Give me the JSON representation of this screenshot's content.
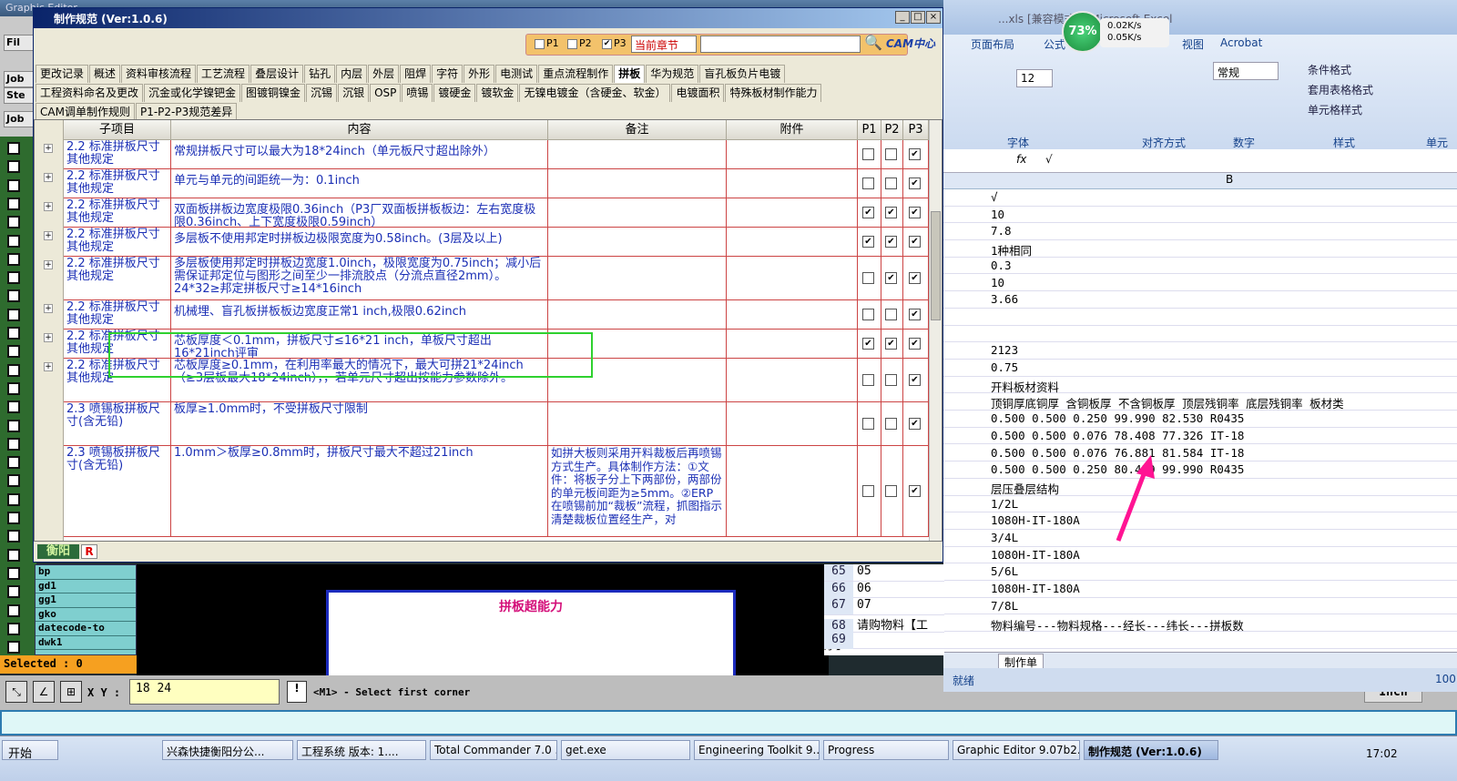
{
  "cam": {
    "left_labels": [
      "Fil",
      "Job",
      "Ste",
      "Job"
    ],
    "layers": [
      "bp",
      "gd1",
      "gg1",
      "gko",
      "datecode-to",
      "dwk1"
    ],
    "selected": "Selected : 0",
    "xy_label": "X Y :",
    "xy_value": "18 24",
    "prompt": "<M1> - Select first corner",
    "draw_label": "拼板超能力",
    "unit": "Inch"
  },
  "dialog": {
    "title": "制作规范 (Ver:1.0.6)",
    "filters": [
      "P1",
      "P2",
      "P3"
    ],
    "filter_checked": [
      false,
      false,
      true
    ],
    "scope": "当前章节",
    "search_value": "",
    "logo": "CAM中心",
    "tabs_row1": [
      "更改记录",
      "概述",
      "资料审核流程",
      "工艺流程",
      "叠层设计",
      "钻孔",
      "内层",
      "外层",
      "阻焊",
      "字符",
      "外形",
      "电测试",
      "重点流程制作",
      "拼板",
      "华为规范",
      "盲孔板负片电镀"
    ],
    "tabs_row2": [
      "工程资料命名及更改",
      "沉金或化学镍钯金",
      "图镀铜镍金",
      "沉锡",
      "沉银",
      "OSP",
      "喷锡",
      "镀硬金",
      "镀软金",
      "无镍电镀金（含硬金、软金）",
      "电镀面积",
      "特殊板材制作能力"
    ],
    "tabs_row3": [
      "CAM调单制作规则",
      "P1-P2-P3规范差异"
    ],
    "active_tab": "拼板",
    "headers": [
      "子项目",
      "内容",
      "备注",
      "附件",
      "P1",
      "P2",
      "P3"
    ],
    "rows": [
      {
        "sub": "2.2 标准拼板尺寸其他规定",
        "content": "常规拼板尺寸可以最大为18*24inch（单元板尺寸超出除外）",
        "note": "",
        "p": [
          false,
          false,
          true
        ]
      },
      {
        "sub": "2.2 标准拼板尺寸其他规定",
        "content": "单元与单元的间距统一为：0.1inch",
        "note": "",
        "p": [
          false,
          false,
          true
        ]
      },
      {
        "sub": "2.2 标准拼板尺寸其他规定",
        "content": "双面板拼板边宽度极限0.36inch（P3厂双面板拼板板边：左右宽度极限0.36inch、上下宽度极限0.59inch）",
        "note": "",
        "p": [
          true,
          true,
          true
        ]
      },
      {
        "sub": "2.2 标准拼板尺寸其他规定",
        "content": "多层板不使用邦定时拼板边极限宽度为0.58inch。(3层及以上)",
        "note": "",
        "p": [
          true,
          true,
          true
        ]
      },
      {
        "sub": "2.2 标准拼板尺寸其他规定",
        "content": "多层板使用邦定时拼板边宽度1.0inch，极限宽度为0.75inch；减小后需保证邦定位与图形之间至少一排流胶点（分流点直径2mm）。24*32≥邦定拼板尺寸≥14*16inch",
        "note": "",
        "p": [
          false,
          true,
          true
        ]
      },
      {
        "sub": "2.2 标准拼板尺寸其他规定",
        "content": "机械埋、盲孔板拼板板边宽度正常1 inch,极限0.62inch",
        "note": "",
        "p": [
          false,
          false,
          true
        ]
      },
      {
        "sub": "2.2 标准拼板尺寸其他规定",
        "content": "芯板厚度＜0.1mm，拼板尺寸≤16*21 inch，单板尺寸超出16*21inch评审",
        "note": "",
        "p": [
          true,
          true,
          true
        ]
      },
      {
        "sub": "2.2 标准拼板尺寸其他规定",
        "content": "芯板厚度≥0.1mm，在利用率最大的情况下，最大可拼21*24inch（≥3层板最大18*24inch），，若单元尺寸超出按能力参数除外。",
        "note": "",
        "p": [
          false,
          false,
          true
        ]
      },
      {
        "sub": "2.3 喷锡板拼板尺寸(含无铅)",
        "content": "板厚≥1.0mm时，不受拼板尺寸限制",
        "note": "",
        "p": [
          false,
          false,
          true
        ]
      },
      {
        "sub": "2.3 喷锡板拼板尺寸(含无铅)",
        "content": "1.0mm＞板厚≥0.8mm时，拼板尺寸最大不超过21inch",
        "note": "如拼大板则采用开料裁板后再喷锡方式生产。具体制作方法：①文件：将板子分上下两部份，两部份的单元板间距为≥5mm。②ERP在喷锡前加“裁板”流程，抓图指示清楚裁板位置经生产，对",
        "p": [
          false,
          false,
          true
        ]
      }
    ],
    "status_left": "衡阳",
    "status_r": "R"
  },
  "excel": {
    "title": "...xls [兼容模式] - Microsoft Excel",
    "tabs": [
      "页面布局",
      "公式",
      "视图",
      "Acrobat"
    ],
    "font_size": "12",
    "number_format": "常规",
    "styles": [
      "条件格式",
      "套用表格格式",
      "单元格样式"
    ],
    "groups": [
      "字体",
      "对齐方式",
      "数字",
      "样式",
      "单元"
    ],
    "formula": "√",
    "col_b": "B",
    "cells": [
      "√",
      "10",
      "7.8",
      "1种相同",
      "0.3",
      "10",
      "3.66",
      "",
      "",
      "2123",
      "0.75",
      "开料板材资料",
      "顶铜厚底铜厚 含铜板厚 不含铜板厚 顶层残铜率 底层残铜率 板材类",
      "0.500  0.500          0.250     99.990    82.530   R0435",
      "0.500  0.500          0.076     78.408    77.326   IT-18",
      "0.500  0.500          0.076     76.881    81.584   IT-18",
      "0.500  0.500          0.250     80.459    99.990   R0435",
      "层压叠层结构",
      "1/2L",
      "1080H-IT-180A",
      "3/4L",
      "1080H-IT-180A",
      "5/6L",
      "1080H-IT-180A",
      "7/8L",
      "物料编号---物料规格---经长---纬长---拼板数",
      ""
    ],
    "left_rows": [
      {
        "n": "65",
        "a": "05"
      },
      {
        "n": "66",
        "a": "06"
      },
      {
        "n": "67",
        "a": "07"
      },
      {
        "n": "68",
        "a": "请购物料【工序】"
      },
      {
        "n": "69",
        "a": ""
      }
    ],
    "sheet": "制作单",
    "status": "就绪",
    "zoom": "100"
  },
  "meter": {
    "percent": "73%",
    "up": "0.02K/s",
    "down": "0.05K/s"
  },
  "taskbar": {
    "start": "开始",
    "items": [
      "兴森快捷衡阳分公...",
      "工程系统  版本: 1....",
      "Total Commander 7.0 ...",
      "get.exe",
      "Engineering Toolkit 9....",
      "Progress",
      "Graphic Editor 9.07b2...",
      "制作规范 (Ver:1.0.6)"
    ],
    "clock": "17:02"
  }
}
